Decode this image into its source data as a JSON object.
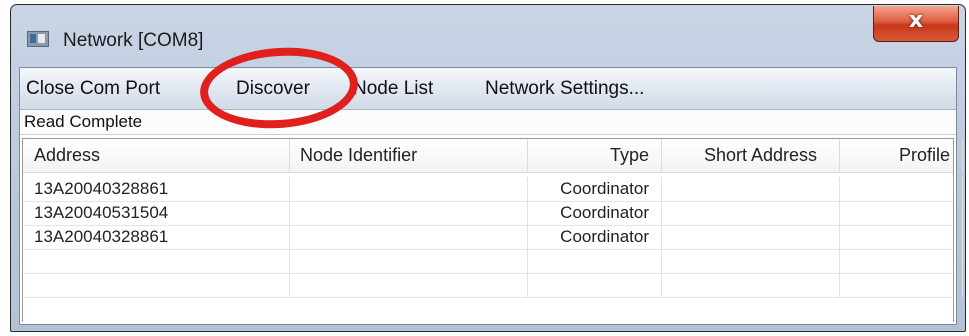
{
  "window": {
    "title": "Network [COM8]",
    "close_glyph": "x"
  },
  "menu": {
    "items": [
      {
        "label": "Close Com Port"
      },
      {
        "label": "Discover"
      },
      {
        "label": "Node List"
      },
      {
        "label": "Network Settings..."
      }
    ]
  },
  "status": {
    "text": "Read Complete"
  },
  "table": {
    "columns": [
      "Address",
      "Node Identifier",
      "Type",
      "Short Address",
      "Profile"
    ],
    "rows": [
      {
        "address": "13A20040328861",
        "node_identifier": "",
        "type": "Coordinator",
        "short_address": "",
        "profile": ""
      },
      {
        "address": "13A20040531504",
        "node_identifier": "",
        "type": "Coordinator",
        "short_address": "",
        "profile": ""
      },
      {
        "address": "13A20040328861",
        "node_identifier": "",
        "type": "Coordinator",
        "short_address": "",
        "profile": ""
      }
    ]
  },
  "icons": {
    "app": "network-window-icon",
    "close": "close-icon"
  },
  "colors": {
    "highlight_ring": "#e0201c",
    "close_button": "#d2462a",
    "titlebar": "#c1cee0"
  }
}
